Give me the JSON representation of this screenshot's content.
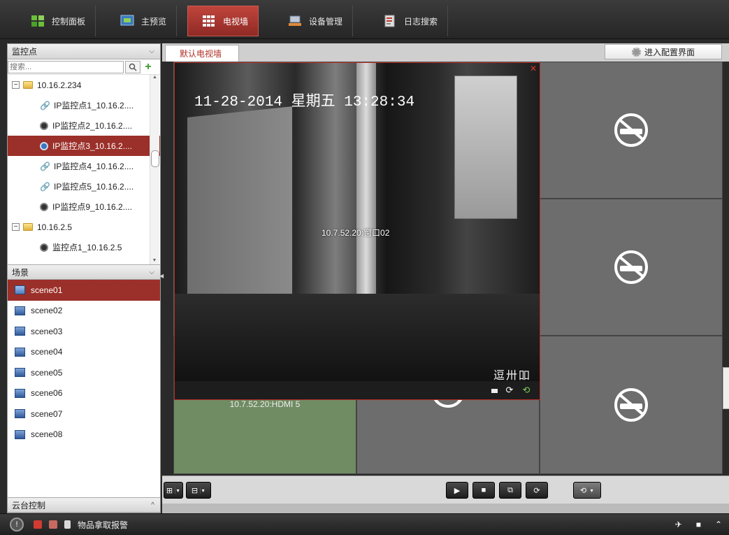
{
  "nav": {
    "tabs": [
      {
        "label": "控制面板",
        "icon": "dashboard-icon"
      },
      {
        "label": "主预览",
        "icon": "preview-icon"
      },
      {
        "label": "电视墙",
        "icon": "tv-wall-icon",
        "active": true
      },
      {
        "label": "设备管理",
        "icon": "device-icon"
      },
      {
        "label": "日志搜索",
        "icon": "log-icon"
      }
    ]
  },
  "left": {
    "monitor_header": "监控点",
    "search_placeholder": "搜索...",
    "tree": [
      {
        "label": "10.16.2.234",
        "type": "group",
        "expanded": true
      },
      {
        "label": "IP监控点1_10.16.2....",
        "type": "linked"
      },
      {
        "label": "IP监控点2_10.16.2....",
        "type": "camera"
      },
      {
        "label": "IP监控点3_10.16.2....",
        "type": "camera",
        "selected": true
      },
      {
        "label": "IP监控点4_10.16.2....",
        "type": "linked"
      },
      {
        "label": "IP监控点5_10.16.2....",
        "type": "linked"
      },
      {
        "label": "IP监控点9_10.16.2....",
        "type": "camera"
      },
      {
        "label": "10.16.2.5",
        "type": "group",
        "expanded": true
      },
      {
        "label": "监控点1_10.16.2.5",
        "type": "camera"
      }
    ],
    "scene_header": "场景",
    "scenes": [
      "scene01",
      "scene02",
      "scene03",
      "scene04",
      "scene05",
      "scene06",
      "scene07",
      "scene08"
    ],
    "selected_scene": "scene01",
    "ptz_header": "云台控制"
  },
  "main": {
    "tab_label": "默认电视墙",
    "config_button": "进入配置界面",
    "video": {
      "osd": "11-28-2014 星期五 13:28:34",
      "window_label": "10.7.52.20:窗口02",
      "corner_text": "逗卅吅"
    },
    "green_cell_label": "10.7.52.20:HDMI 5"
  },
  "status": {
    "alarm_text": "物品拿取报警"
  },
  "colors": {
    "accent": "#9b2f29",
    "nav_bg": "#2e2e2e",
    "cell_bg": "#6d6d6d",
    "green_cell": "#6f8c63"
  }
}
